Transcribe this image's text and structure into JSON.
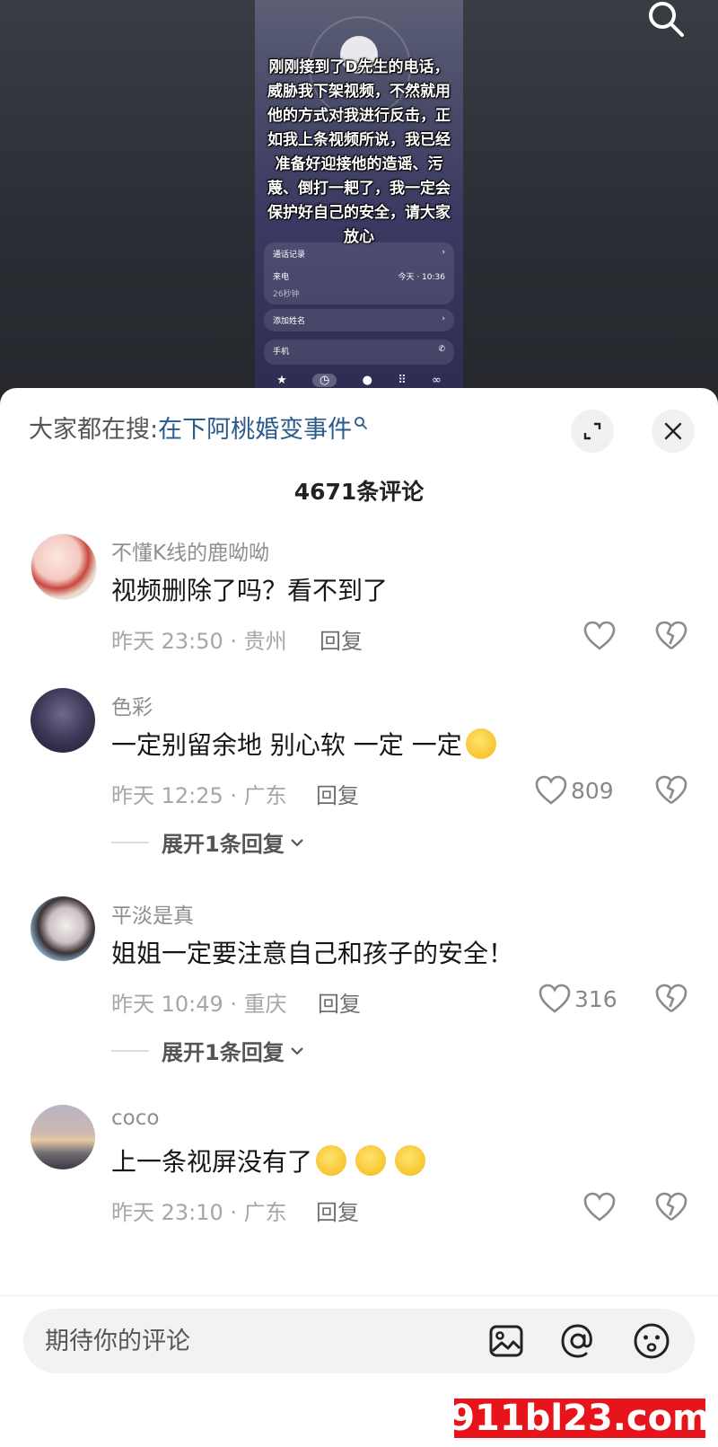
{
  "video": {
    "caption": "刚刚接到了D先生的电话，威胁我下架视频，不然就用他的方式对我进行反击，正如我上条视频所说，我已经准备好迎接他的造谣、污蔑、倒打一耙了，我一定会保护好自己的安全，请大家放心",
    "call_log_label": "通话记录",
    "call_type": "来电",
    "call_time": "今天 · 10:36",
    "call_duration": "26秒钟",
    "add_name_label": "添加姓名",
    "phone_label": "手机"
  },
  "sheet": {
    "search_prefix": "大家都在搜:",
    "search_term": "在下阿桃婚变事件",
    "comment_count": "4671条评论"
  },
  "comments": [
    {
      "username": "不懂K线的鹿呦呦",
      "text": "视频删除了吗？看不到了",
      "meta": "昨天 23:50 · 贵州",
      "reply": "回复",
      "likes": ""
    },
    {
      "username": "色彩",
      "text": "一定别留余地 别心软 一定 一定",
      "meta": "昨天 12:25 · 广东",
      "reply": "回复",
      "likes": "809",
      "expand": "展开1条回复"
    },
    {
      "username": "平淡是真",
      "text": "姐姐一定要注意自己和孩子的安全！",
      "meta": "昨天 10:49 · 重庆",
      "reply": "回复",
      "likes": "316",
      "expand": "展开1条回复"
    },
    {
      "username": "coco",
      "text": "上一条视屏没有了",
      "meta": "昨天 23:10 · 广东",
      "reply": "回复",
      "likes": ""
    }
  ],
  "input": {
    "placeholder": "期待你的评论"
  },
  "watermark": {
    "text": "911bl23.com"
  },
  "colors": {
    "link": "#2b5a8c",
    "watermark_bg": "#e8141c"
  },
  "icons": [
    "search-icon",
    "expand-icon",
    "close-icon",
    "heart-icon",
    "dislike-heart-icon",
    "image-icon",
    "at-icon",
    "emoji-icon",
    "chevron-down-icon"
  ]
}
